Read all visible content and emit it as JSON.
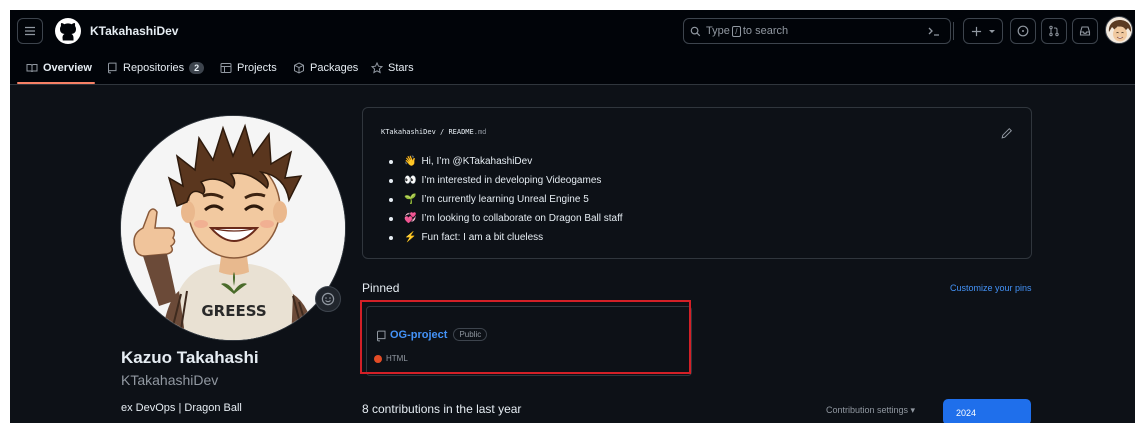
{
  "header": {
    "username": "KTakahashiDev",
    "search_placeholder": "Type / to search",
    "search_prefix": "Type",
    "search_key": "/",
    "search_suffix": "to search",
    "icons": [
      "menu-icon",
      "github-logo-icon",
      "search-icon",
      "command-palette-icon",
      "plus-icon",
      "chevron-down-icon",
      "issues-icon",
      "pull-requests-icon",
      "inbox-icon",
      "avatar"
    ]
  },
  "tabs": [
    {
      "label": "Overview",
      "icon": "book-icon",
      "selected": true
    },
    {
      "label": "Repositories",
      "icon": "repo-icon",
      "count": "2"
    },
    {
      "label": "Projects",
      "icon": "table-icon"
    },
    {
      "label": "Packages",
      "icon": "package-icon"
    },
    {
      "label": "Stars",
      "icon": "star-icon"
    }
  ],
  "profile": {
    "full_name": "Kazuo Takahashi",
    "login": "KTakahashiDev",
    "bio": "ex DevOps | Dragon Ball",
    "shirt_text": "GREESS"
  },
  "readme": {
    "owner": "KTakahashiDev",
    "separator": "/",
    "file": "README",
    "ext": ".md",
    "items": [
      {
        "emoji": "👋",
        "text": "Hi, I’m @KTakahashiDev"
      },
      {
        "emoji": "👀",
        "text": "I’m interested in developing Videogames"
      },
      {
        "emoji": "🌱",
        "text": "I’m currently learning Unreal Engine 5"
      },
      {
        "emoji": "💞️",
        "text": "I’m looking to collaborate on Dragon Ball staff"
      },
      {
        "emoji": "⚡",
        "text": "Fun fact: I am a bit clueless"
      }
    ]
  },
  "pinned": {
    "title": "Pinned",
    "customize_label": "Customize your pins",
    "repos": [
      {
        "name": "OG-project",
        "visibility": "Public",
        "language": "HTML",
        "language_color": "#e34c26"
      }
    ]
  },
  "contributions": {
    "summary": "8 contributions in the last year",
    "settings_label": "Contribution settings ▾",
    "year": "2024"
  },
  "colors": {
    "background": "#0d1117",
    "header": "#010409",
    "accent_blue": "#4493f8",
    "selected_tab": "#f78166",
    "highlight_box": "#d32027",
    "year_button": "#1f6feb"
  }
}
